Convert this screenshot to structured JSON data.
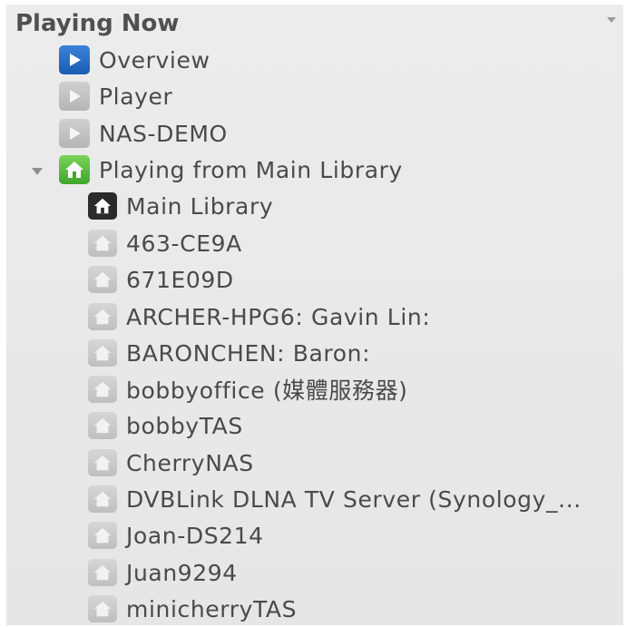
{
  "header": {
    "title": "Playing Now"
  },
  "zones": [
    {
      "label": "Overview",
      "icon": "play-icon",
      "active": true
    },
    {
      "label": "Player",
      "icon": "play-icon",
      "active": false
    },
    {
      "label": "NAS-DEMO",
      "icon": "play-icon",
      "active": false
    }
  ],
  "library_group": {
    "label": "Playing from Main Library",
    "icon": "home-icon",
    "expanded": true
  },
  "libraries": [
    {
      "label": "Main Library",
      "icon": "home-icon",
      "selected": true
    },
    {
      "label": "463-CE9A",
      "icon": "home-icon",
      "selected": false
    },
    {
      "label": "671E09D",
      "icon": "home-icon",
      "selected": false
    },
    {
      "label": "ARCHER-HPG6: Gavin Lin:",
      "icon": "home-icon",
      "selected": false
    },
    {
      "label": "BARONCHEN: Baron:",
      "icon": "home-icon",
      "selected": false
    },
    {
      "label": "bobbyoffice (媒體服務器)",
      "icon": "home-icon",
      "selected": false
    },
    {
      "label": "bobbyTAS",
      "icon": "home-icon",
      "selected": false
    },
    {
      "label": "CherryNAS",
      "icon": "home-icon",
      "selected": false
    },
    {
      "label": "DVBLink DLNA TV Server (Synology_...",
      "icon": "home-icon",
      "selected": false
    },
    {
      "label": "Joan-DS214",
      "icon": "home-icon",
      "selected": false
    },
    {
      "label": "Juan9294",
      "icon": "home-icon",
      "selected": false
    },
    {
      "label": "minicherryTAS",
      "icon": "home-icon",
      "selected": false
    }
  ],
  "colors": {
    "overview_icon": "#1b5cb3",
    "inactive_zone_icon": "#b5b5b5",
    "group_icon": "#3ea52a",
    "selected_library_icon": "#2b2b2b",
    "library_icon": "#c7c7c7"
  }
}
